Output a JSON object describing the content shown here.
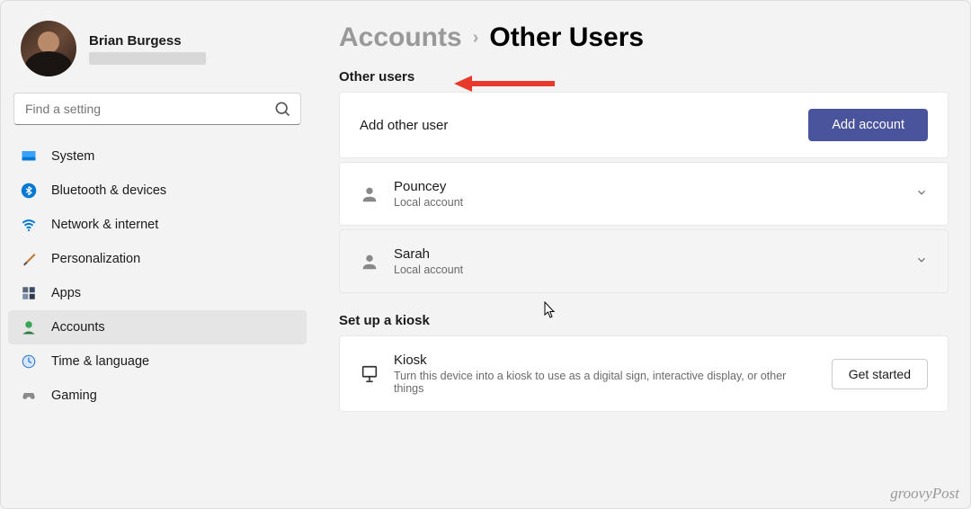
{
  "profile": {
    "name": "Brian Burgess"
  },
  "search": {
    "placeholder": "Find a setting"
  },
  "nav": {
    "system": "System",
    "bluetooth": "Bluetooth & devices",
    "network": "Network & internet",
    "personalization": "Personalization",
    "apps": "Apps",
    "accounts": "Accounts",
    "time": "Time & language",
    "gaming": "Gaming"
  },
  "breadcrumb": {
    "parent": "Accounts",
    "current": "Other Users"
  },
  "section": {
    "other_users": "Other users",
    "kiosk": "Set up a kiosk"
  },
  "add_user": {
    "label": "Add other user",
    "button": "Add account"
  },
  "users": {
    "0": {
      "name": "Pouncey",
      "type": "Local account"
    },
    "1": {
      "name": "Sarah",
      "type": "Local account"
    }
  },
  "kiosk": {
    "title": "Kiosk",
    "desc": "Turn this device into a kiosk to use as a digital sign, interactive display, or other things",
    "button": "Get started"
  },
  "watermark": "groovyPost"
}
